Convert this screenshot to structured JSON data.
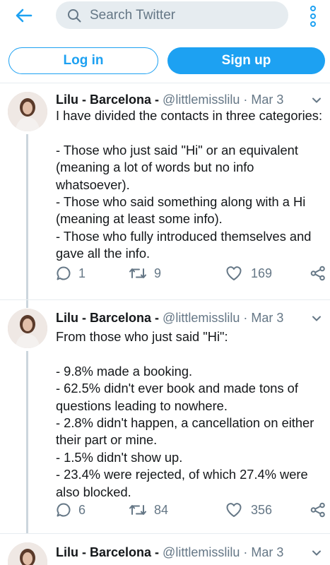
{
  "search": {
    "placeholder": "Search Twitter"
  },
  "auth": {
    "login_label": "Log in",
    "signup_label": "Sign up"
  },
  "colors": {
    "accent": "#1da1f2",
    "muted": "#657786",
    "text": "#14171a",
    "divider": "#e6ecf0"
  },
  "icons": {
    "back": "arrow-left-icon",
    "search": "search-icon",
    "more": "more-vertical-icon",
    "reply": "reply-icon",
    "retweet": "retweet-icon",
    "like": "heart-icon",
    "share": "share-icon",
    "caret": "chevron-down-icon"
  },
  "tweets": [
    {
      "name": "Lilu - Barcelona -",
      "handle": "@littlemisslilu",
      "dot": "·",
      "date": "Mar 3",
      "text": "I have divided the contacts in three categories:\n\n- Those who just said \"Hi\" or an equivalent (meaning a lot of words but no info whatsoever).\n- Those who said something along with a Hi (meaning at least some info).\n- Those who fully introduced themselves and gave all the info.",
      "replies": "1",
      "retweets": "9",
      "likes": "169"
    },
    {
      "name": "Lilu - Barcelona -",
      "handle": "@littlemisslilu",
      "dot": "·",
      "date": "Mar 3",
      "text": "From those who just said \"Hi\":\n\n- 9.8% made a booking.\n- 62.5% didn't ever book and made tons of questions leading to nowhere.\n- 2.8% didn't happen, a cancellation on either their part or mine.\n- 1.5% didn't show up.\n- 23.4% were rejected, of which 27.4% were also blocked.",
      "replies": "6",
      "retweets": "84",
      "likes": "356"
    },
    {
      "name": "Lilu - Barcelona -",
      "handle": "@littlemisslilu",
      "dot": "·",
      "date": "Mar 3"
    }
  ]
}
